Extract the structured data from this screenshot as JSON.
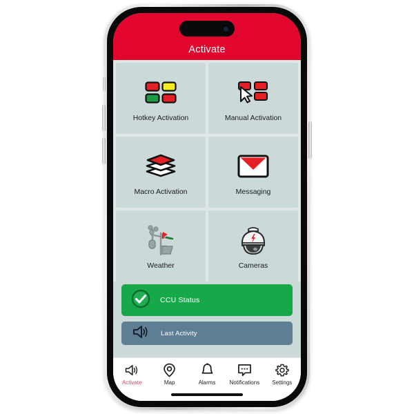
{
  "app": {
    "header_title": "Activate",
    "header_color": "#e2062f",
    "screen_background": "#ccd9d9"
  },
  "tiles": [
    {
      "label": "Hotkey Activation",
      "icon": "hotkey-grid-icon"
    },
    {
      "label": "Manual Activation",
      "icon": "cursor-grid-icon"
    },
    {
      "label": "Macro Activation",
      "icon": "layers-icon"
    },
    {
      "label": "Messaging",
      "icon": "envelope-icon"
    },
    {
      "label": "Weather",
      "icon": "weather-station-icon"
    },
    {
      "label": "Cameras",
      "icon": "dome-camera-icon"
    }
  ],
  "status_rows": [
    {
      "label": "CCU Status",
      "icon": "check-circle-icon",
      "color": "#17a84a"
    },
    {
      "label": "Last Activity",
      "icon": "speaker-icon",
      "color": "#5d7e93"
    }
  ],
  "tabbar": {
    "items": [
      {
        "label": "Activate",
        "icon": "speaker-icon",
        "active": true
      },
      {
        "label": "Map",
        "icon": "map-pin-icon",
        "active": false
      },
      {
        "label": "Alarms",
        "icon": "bell-icon",
        "active": false
      },
      {
        "label": "Notifications",
        "icon": "chat-bubble-icon",
        "active": false
      },
      {
        "label": "Settings",
        "icon": "gear-icon",
        "active": false
      }
    ],
    "active_color": "#e2405f",
    "inactive_color": "#1d1d1d"
  }
}
